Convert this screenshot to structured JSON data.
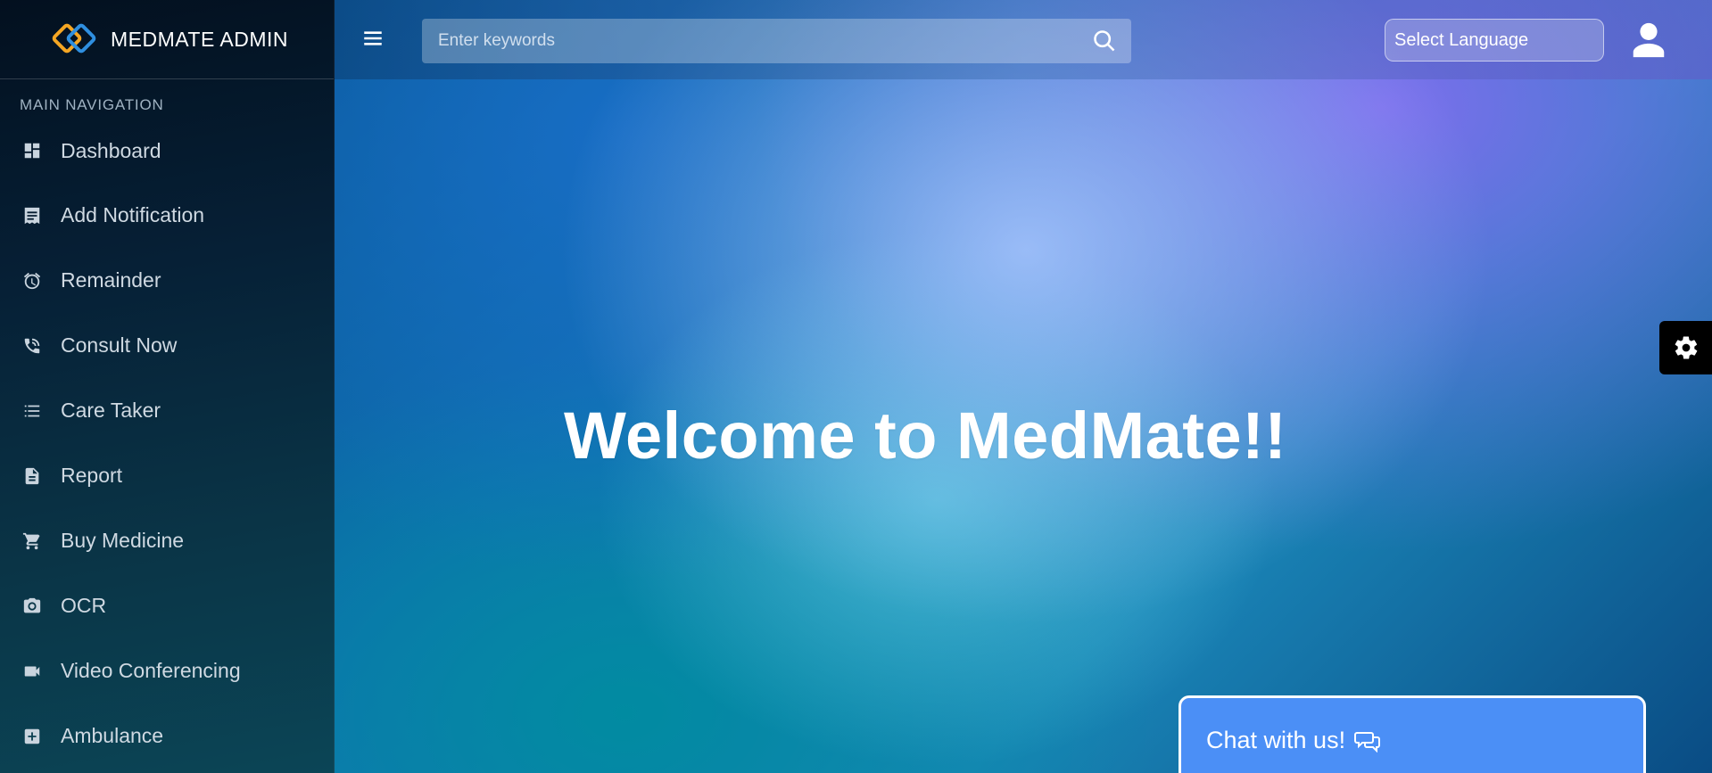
{
  "brand": {
    "name": "MEDMATE ADMIN",
    "logo_colors": [
      "#f5a623",
      "#2f8fe0"
    ]
  },
  "sidebar": {
    "heading": "MAIN NAVIGATION",
    "items": [
      {
        "label": "Dashboard",
        "icon": "dashboard-icon"
      },
      {
        "label": "Add Notification",
        "icon": "receipt-icon"
      },
      {
        "label": "Remainder",
        "icon": "alarm-clock-icon"
      },
      {
        "label": "Consult Now",
        "icon": "phone-call-icon"
      },
      {
        "label": "Care Taker",
        "icon": "list-icon"
      },
      {
        "label": "Report",
        "icon": "document-icon"
      },
      {
        "label": "Buy Medicine",
        "icon": "shopping-cart-icon"
      },
      {
        "label": "OCR",
        "icon": "camera-icon"
      },
      {
        "label": "Video Conferencing",
        "icon": "video-camera-icon"
      },
      {
        "label": "Ambulance",
        "icon": "plus-box-icon"
      }
    ]
  },
  "topbar": {
    "menu_icon": "hamburger-menu-icon",
    "search_placeholder": "Enter keywords",
    "search_icon": "search-icon",
    "language_select": "Select Language",
    "user_icon": "user-icon"
  },
  "main": {
    "welcome_text": "Welcome to MedMate!!"
  },
  "settings_tab": {
    "icon": "gear-icon"
  },
  "chat_widget": {
    "label": "Chat with us!",
    "icon": "chat-bubbles-icon",
    "color": "#4b8ff6"
  }
}
